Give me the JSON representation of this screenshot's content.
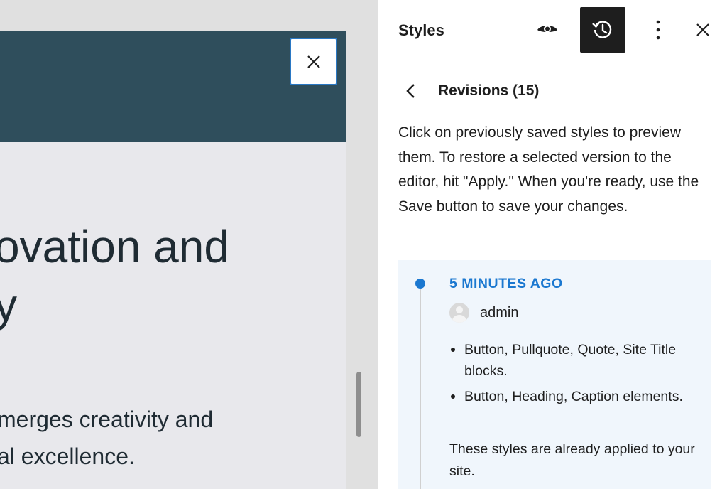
{
  "canvas": {
    "preview_heading": "ovation and\ny",
    "preview_body": "merges creativity and\nal excellence."
  },
  "sidebar": {
    "title": "Styles",
    "header_icons": [
      "eye-icon",
      "revisions-history-icon",
      "more-vertical-icon",
      "close-icon"
    ],
    "nav": {
      "heading": "Revisions (15)"
    },
    "description": "Click on previously saved styles to preview them. To restore a selected version to the editor, hit \"Apply.\" When you're ready, use the Save button to save your changes.",
    "revision": {
      "time": "5 MINUTES AGO",
      "author": "admin",
      "changes": [
        "Button, Pullquote, Quote, Site Title blocks.",
        "Button, Heading, Caption elements."
      ],
      "note": "These styles are already applied to your site."
    }
  },
  "colors": {
    "preview_header_bg": "#2f4e5c",
    "accent": "#1b78d0",
    "active_button_bg": "#1e1e1e",
    "card_bg": "#f0f6fc"
  }
}
